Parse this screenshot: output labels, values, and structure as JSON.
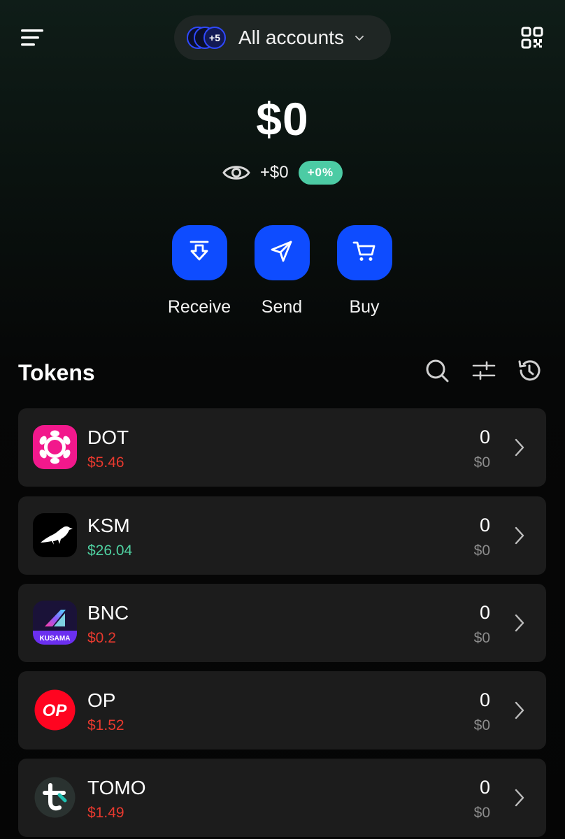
{
  "header": {
    "account_selector": {
      "label": "All accounts",
      "extra_count": "+5"
    }
  },
  "balance": {
    "total": "$0",
    "change_amount": "+$0",
    "change_percent": "+0%"
  },
  "actions": [
    {
      "label": "Receive",
      "icon": "receive-icon"
    },
    {
      "label": "Send",
      "icon": "send-icon"
    },
    {
      "label": "Buy",
      "icon": "cart-icon"
    }
  ],
  "tokens": {
    "title": "Tokens",
    "items": [
      {
        "symbol": "DOT",
        "price": "$5.46",
        "price_color": "#e8392e",
        "balance": "0",
        "value": "$0"
      },
      {
        "symbol": "KSM",
        "price": "$26.04",
        "price_color": "#4fd1a1",
        "balance": "0",
        "value": "$0"
      },
      {
        "symbol": "BNC",
        "price": "$0.2",
        "price_color": "#e8392e",
        "balance": "0",
        "value": "$0",
        "logo_text": "KUSAMA"
      },
      {
        "symbol": "OP",
        "price": "$1.52",
        "price_color": "#e8392e",
        "balance": "0",
        "value": "$0",
        "logo_text": "OP"
      },
      {
        "symbol": "TOMO",
        "price": "$1.49",
        "price_color": "#e8392e",
        "balance": "0",
        "value": "$0"
      }
    ]
  },
  "colors": {
    "accent": "#0e4cff",
    "positive": "#4ccba4",
    "negative": "#e8392e"
  }
}
